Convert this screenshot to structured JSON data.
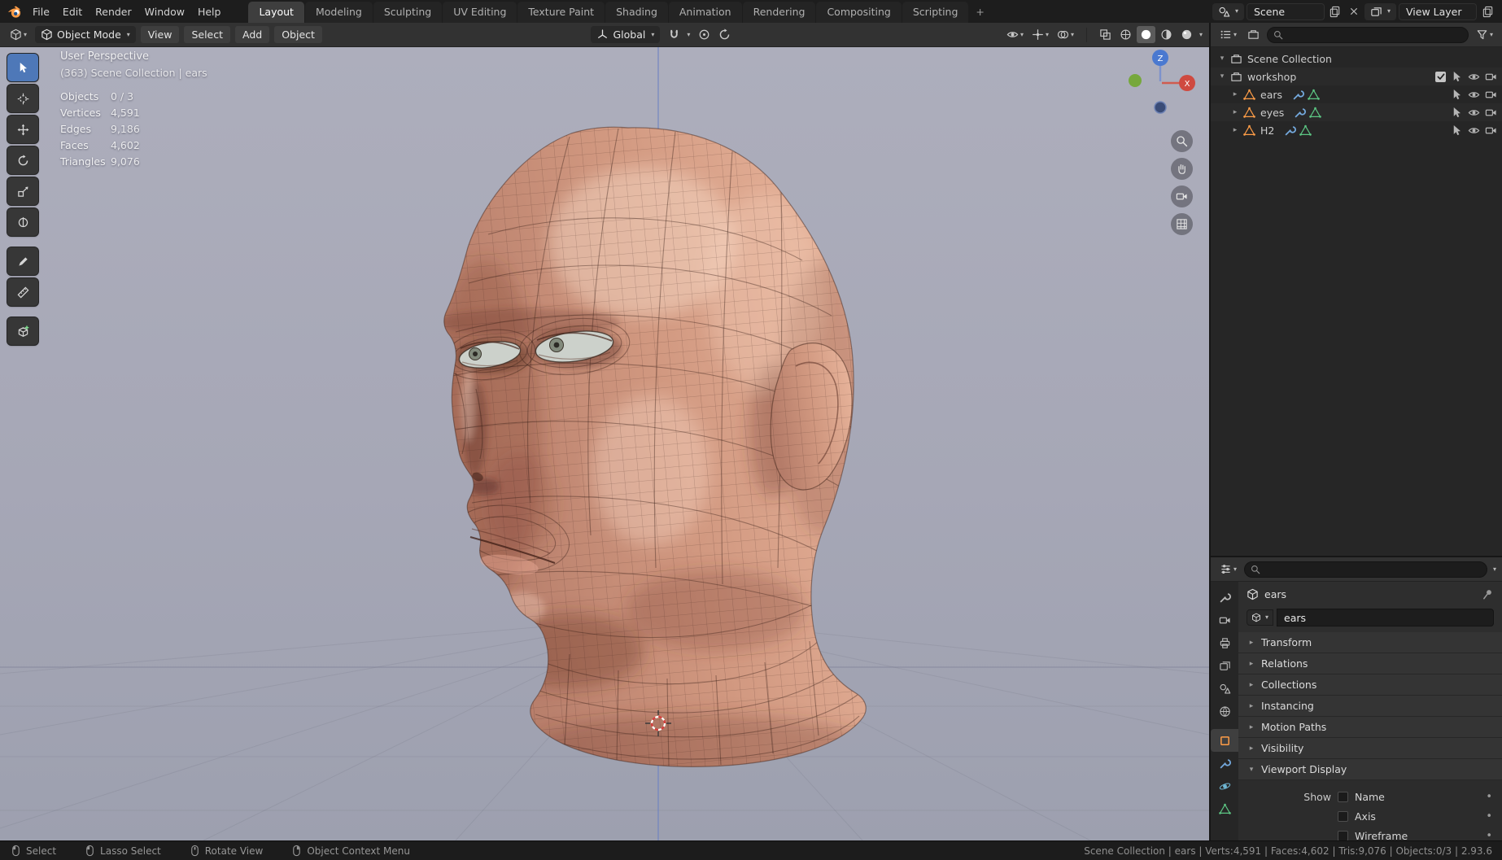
{
  "topbar": {
    "menus": [
      "File",
      "Edit",
      "Render",
      "Window",
      "Help"
    ],
    "tabs": [
      "Layout",
      "Modeling",
      "Sculpting",
      "UV Editing",
      "Texture Paint",
      "Shading",
      "Animation",
      "Rendering",
      "Compositing",
      "Scripting"
    ],
    "active_tab": "Layout",
    "new_tab": "+",
    "scene": "Scene",
    "view_layer": "View Layer"
  },
  "viewport": {
    "header": {
      "mode": "Object Mode",
      "menus": [
        "View",
        "Select",
        "Add",
        "Object"
      ],
      "orientation": "Global"
    },
    "overlay": {
      "view": "User Perspective",
      "context": "(363) Scene Collection | ears",
      "stats": [
        {
          "label": "Objects",
          "value": "0 / 3"
        },
        {
          "label": "Vertices",
          "value": "4,591"
        },
        {
          "label": "Edges",
          "value": "9,186"
        },
        {
          "label": "Faces",
          "value": "4,602"
        },
        {
          "label": "Triangles",
          "value": "9,076"
        }
      ]
    },
    "gizmo": {
      "z": "Z",
      "x": "X"
    }
  },
  "outliner": {
    "root": "Scene Collection",
    "collection": "workshop",
    "objects": [
      "ears",
      "eyes",
      "H2"
    ]
  },
  "properties": {
    "breadcrumb": "ears",
    "name_value": "ears",
    "sections": [
      "Transform",
      "Relations",
      "Collections",
      "Instancing",
      "Motion Paths",
      "Visibility"
    ],
    "viewport_display": {
      "label": "Viewport Display",
      "show": "Show",
      "options": [
        "Name",
        "Axis",
        "Wireframe"
      ]
    }
  },
  "statusbar": {
    "hints": [
      "Select",
      "Lasso Select",
      "Rotate View",
      "Object Context Menu"
    ],
    "info": "Scene Collection | ears | Verts:4,591 | Faces:4,602 | Tris:9,076 | Objects:0/3 | 2.93.6"
  },
  "colors": {
    "accent": "#4e78b8",
    "blender_orange": "#ff9d47",
    "axis_x": "#cf4a40",
    "axis_y": "#76a83c",
    "axis_z": "#4a79d0",
    "skin": "#d9a08d"
  }
}
